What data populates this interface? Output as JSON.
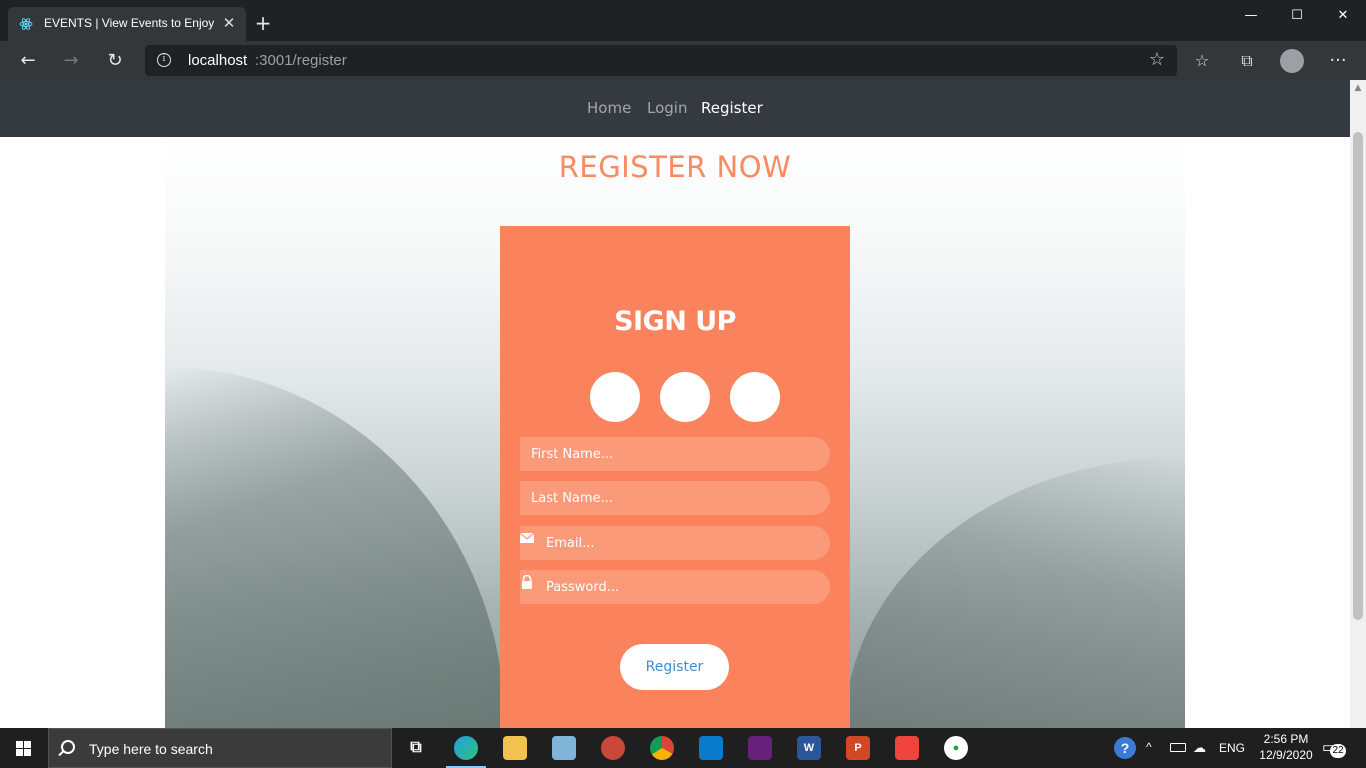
{
  "browser": {
    "tab_title": "EVENTS | View Events to Enjoy",
    "url_host": "localhost",
    "url_path": ":3001/register"
  },
  "site_nav": {
    "links": [
      {
        "label": "Home",
        "active": false
      },
      {
        "label": "Login",
        "active": false
      },
      {
        "label": "Register",
        "active": true
      }
    ]
  },
  "page": {
    "heading": "REGISTER NOW",
    "heading_color": "#fa8a61"
  },
  "signup": {
    "title": "SIGN UP",
    "card_color": "#fa835d",
    "social_buttons": [
      "social-button",
      "social-button",
      "social-button"
    ],
    "fields": {
      "first_name_placeholder": "First Name...",
      "last_name_placeholder": "Last Name...",
      "email_placeholder": "Email...",
      "password_placeholder": "Password..."
    },
    "register_label": "Register"
  },
  "taskbar": {
    "search_placeholder": "Type here to search",
    "language": "ENG",
    "time": "2:56 PM",
    "date": "12/9/2020",
    "notification_count": "22"
  }
}
